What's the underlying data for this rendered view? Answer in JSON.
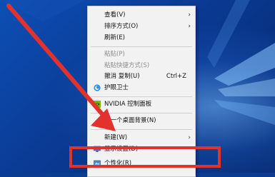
{
  "menu": {
    "items": [
      {
        "label": "查看(V)"
      },
      {
        "label": "排序方式(O)"
      },
      {
        "label": "刷新(E)"
      },
      {
        "label": "粘贴(P)"
      },
      {
        "label": "粘贴快捷方式(S)"
      },
      {
        "label": "撤消 复制(U)",
        "shortcut": "Ctrl+Z"
      },
      {
        "label": "护眼卫士"
      },
      {
        "label": "NVIDIA 控制面板"
      },
      {
        "label": "下一个桌面背景(N)"
      },
      {
        "label": "新建(W)"
      },
      {
        "label": "显示设置(D)"
      },
      {
        "label": "个性化(R)"
      }
    ]
  },
  "colors": {
    "annotation_red": "#e3312d",
    "menu_bg": "#f2f2f2",
    "desktop_blue": "#0a3d8f"
  },
  "icons": [
    "chevron-right-icon",
    "eye-guard-icon",
    "nvidia-icon",
    "display-settings-icon",
    "personalize-icon"
  ]
}
